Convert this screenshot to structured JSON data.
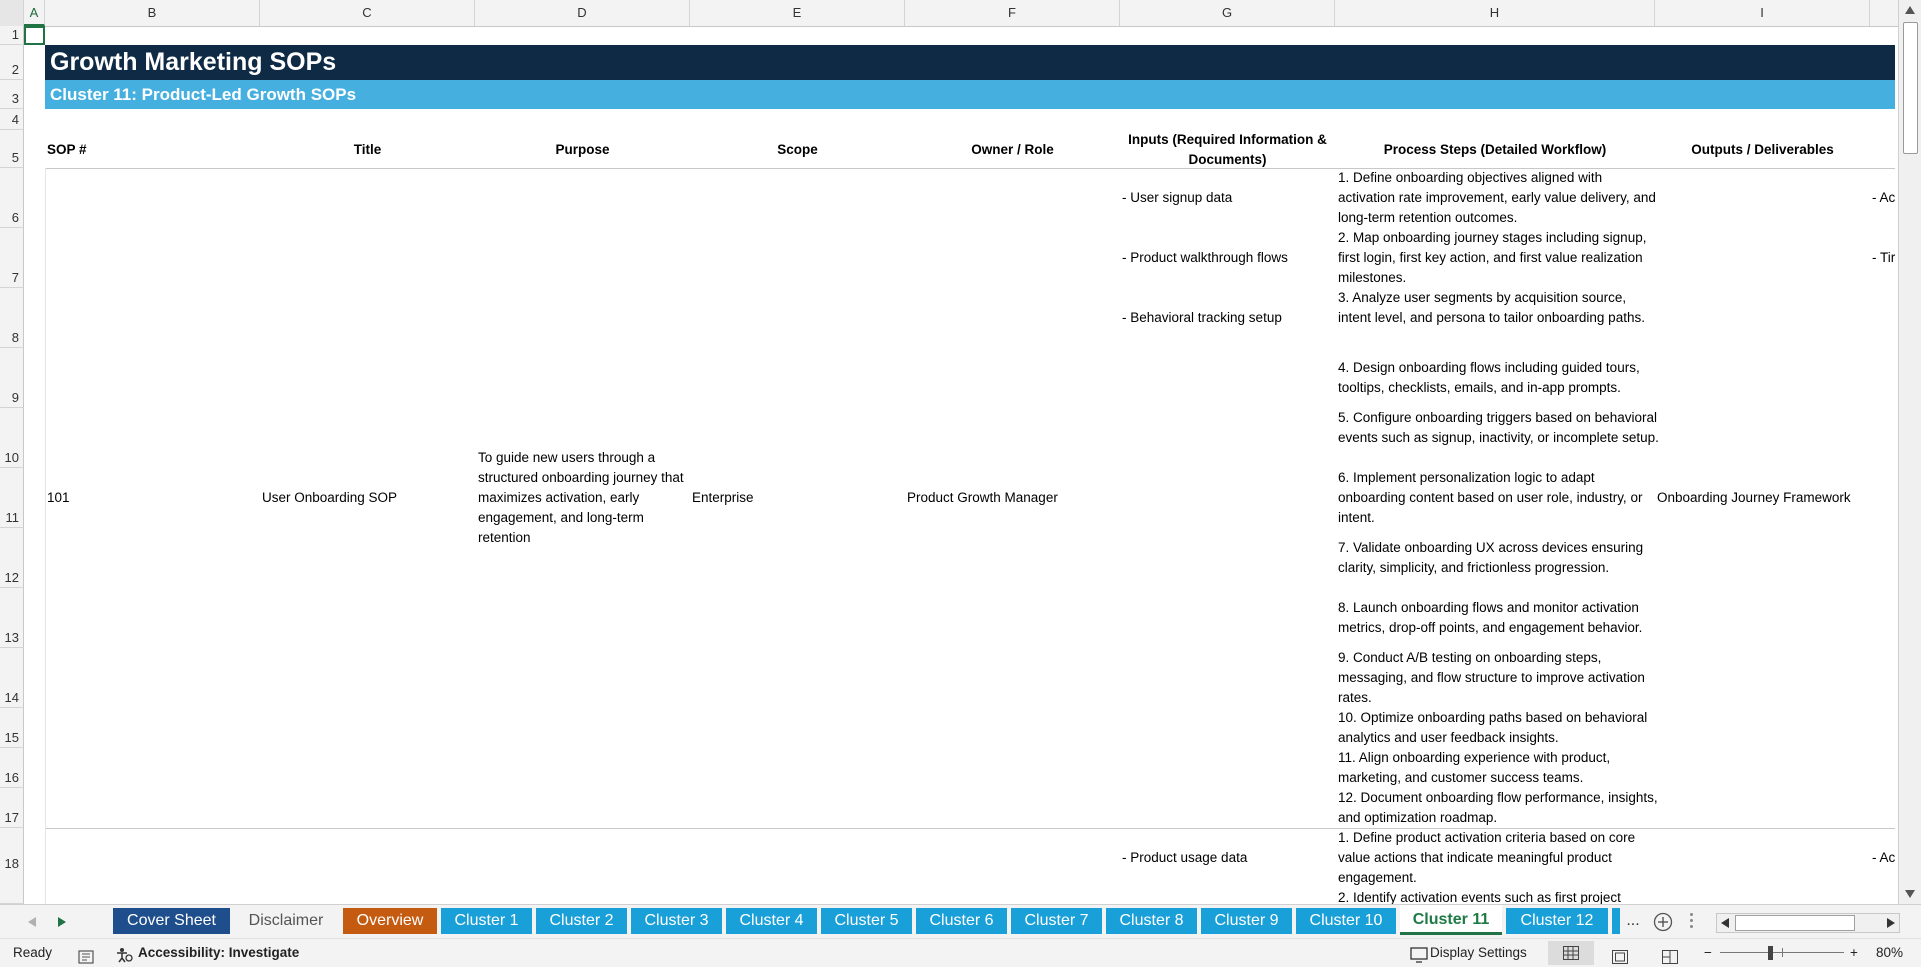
{
  "columns": [
    "A",
    "B",
    "C",
    "D",
    "E",
    "F",
    "G",
    "H",
    "I"
  ],
  "rows": [
    "1",
    "2",
    "3",
    "4",
    "5",
    "6",
    "7",
    "8",
    "9",
    "10",
    "11",
    "12",
    "13",
    "14",
    "15",
    "16",
    "17",
    "18"
  ],
  "sheet": {
    "title": "Growth Marketing SOPs",
    "subtitle": "Cluster 11: Product-Led Growth SOPs",
    "headers": {
      "sop": "SOP #",
      "title": "Title",
      "purpose": "Purpose",
      "scope": "Scope",
      "owner": "Owner / Role",
      "inputs": "Inputs (Required Information & Documents)",
      "steps": "Process Steps (Detailed Workflow)",
      "outputs": "Outputs / Deliverables"
    },
    "record1": {
      "sop": "101",
      "title": "User Onboarding SOP",
      "purpose": "To guide new users through a structured onboarding journey that maximizes activation, early engagement, and long-term retention",
      "scope": "Enterprise",
      "owner": "Product Growth Manager",
      "inputs": [
        "- User signup data",
        "- Product walkthrough flows",
        "- Behavioral tracking setup"
      ],
      "steps": [
        "1. Define onboarding objectives aligned with activation rate improvement, early value delivery, and long-term retention outcomes.",
        "2. Map onboarding journey stages including signup, first login, first key action, and first value realization milestones.",
        "3. Analyze user segments by acquisition source, intent level, and persona to tailor onboarding paths.",
        "4. Design onboarding flows including guided tours, tooltips, checklists, emails, and in-app prompts.",
        "5. Configure onboarding triggers based on behavioral events such as signup, inactivity, or incomplete setup.",
        "6. Implement personalization logic to adapt onboarding content based on user role, industry, or intent.",
        "7. Validate onboarding UX across devices ensuring clarity, simplicity, and frictionless progression.",
        "8. Launch onboarding flows and monitor activation metrics, drop-off points, and engagement behavior.",
        "9. Conduct A/B testing on onboarding steps, messaging, and flow structure to improve activation rates.",
        "10. Optimize onboarding paths based on behavioral analytics and user feedback insights.",
        "11. Align onboarding experience with product, marketing, and customer success teams.",
        "12. Document onboarding flow performance, insights, and optimization roadmap."
      ],
      "output": "Onboarding Journey Framework",
      "next_col": [
        "- Ac",
        "- Tir"
      ]
    },
    "record2": {
      "inputs": [
        "- Product usage data"
      ],
      "steps": [
        "1. Define product activation criteria based on core value actions that indicate meaningful product engagement.",
        "2. Identify activation events such as first project"
      ],
      "next_col": [
        "- Ac"
      ]
    }
  },
  "tabs": [
    {
      "label": "Cover Sheet",
      "color": "#1f4e8c"
    },
    {
      "label": "Disclaimer",
      "color": "#f3f3f3"
    },
    {
      "label": "Overview",
      "color": "#c55a11"
    },
    {
      "label": "Cluster 1",
      "color": "#1aa0d8"
    },
    {
      "label": "Cluster 2",
      "color": "#1aa0d8"
    },
    {
      "label": "Cluster 3",
      "color": "#1aa0d8"
    },
    {
      "label": "Cluster 4",
      "color": "#1aa0d8"
    },
    {
      "label": "Cluster 5",
      "color": "#1aa0d8"
    },
    {
      "label": "Cluster 6",
      "color": "#1aa0d8"
    },
    {
      "label": "Cluster 7",
      "color": "#1aa0d8"
    },
    {
      "label": "Cluster 8",
      "color": "#1aa0d8"
    },
    {
      "label": "Cluster 9",
      "color": "#1aa0d8"
    },
    {
      "label": "Cluster 10",
      "color": "#1aa0d8"
    },
    {
      "label": "Cluster 11",
      "color": "#ffffff"
    },
    {
      "label": "Cluster 12",
      "color": "#1aa0d8"
    }
  ],
  "tab_more": "...",
  "status": {
    "ready": "Ready",
    "accessibility": "Accessibility: Investigate",
    "display_settings": "Display Settings",
    "zoom": "80%"
  },
  "icons": {
    "prev_tab": "triangle-left-icon",
    "next_tab": "triangle-right-icon",
    "add_sheet": "plus-circle-icon",
    "macro": "macro-recording-icon"
  }
}
